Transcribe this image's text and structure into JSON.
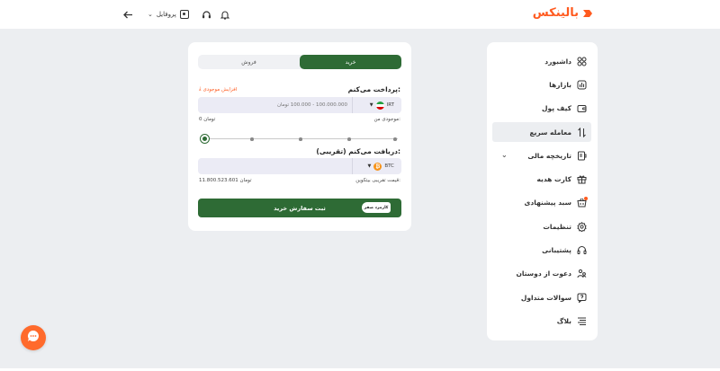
{
  "header": {
    "logo_text": "بالینکس",
    "profile_label": "پروفایل"
  },
  "sidebar": {
    "items": [
      {
        "label": "داشبورد",
        "icon": "dashboard-icon"
      },
      {
        "label": "بازارها",
        "icon": "markets-icon"
      },
      {
        "label": "کیف پول",
        "icon": "wallet-icon"
      },
      {
        "label": "معامله سریع",
        "icon": "swap-icon",
        "active": true
      },
      {
        "label": "تاریخچه مالی",
        "icon": "history-icon",
        "expandable": true
      },
      {
        "label": "کارت هدیه",
        "icon": "gift-icon"
      },
      {
        "label": "سبد پیشنهادی",
        "icon": "basket-icon",
        "badge": true
      },
      {
        "label": "تنظیمات",
        "icon": "settings-icon"
      },
      {
        "label": "پشتیبانی",
        "icon": "headset-icon"
      },
      {
        "label": "دعوت از دوستان",
        "icon": "invite-icon"
      },
      {
        "label": "سوالات متداول",
        "icon": "faq-icon"
      },
      {
        "label": "بلاگ",
        "icon": "blog-icon"
      }
    ]
  },
  "trade": {
    "tab_buy": "خرید",
    "tab_sell": "فروش",
    "pay_label": "پرداخت می‌کنم:",
    "increase_balance": "افزایش موجودی",
    "pay_currency": "IRT",
    "pay_placeholder": "100.000.000 - 100.000 تومان",
    "my_balance_label": "موجودی من:",
    "my_balance_value": "0 تومان",
    "slider_value_percent": 0,
    "receive_label": "دریافت می‌کنم (تقریبی):",
    "receive_currency": "BTC",
    "receive_value": "",
    "approx_price_label": "قیمت تقریبی بیتکوین:",
    "approx_price_value": "11.800.523.601 تومان",
    "submit_label": "ثبت سفارش خرید",
    "zero_fee_badge": "کارمزد صفر"
  },
  "colors": {
    "brand_green": "#2e6b35",
    "brand_orange": "#ff5a1f",
    "background": "#eceef1"
  }
}
